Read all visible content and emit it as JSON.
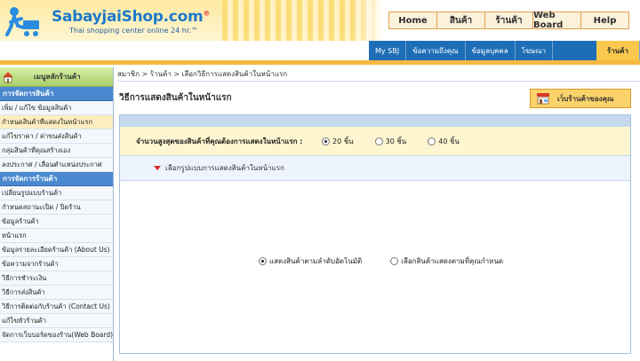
{
  "header": {
    "logo_text": "SabayjaiShop.com",
    "logo_reg": "®",
    "tagline": "Thai shopping center online 24 hr.™",
    "top_nav": [
      "Home",
      "สินค้า",
      "ร้านค้า",
      "Web Board",
      "Help"
    ],
    "sub_nav": [
      "My SBJ",
      "ข้อความถึงคุณ",
      "ข้อมูลบุคคล",
      "โฆษณา"
    ],
    "sub_nav_active": "ร้านค้า"
  },
  "sidebar": {
    "home_label": "เมนูหลักร้านค้า",
    "section1_title": "การจัดการสินค้า",
    "section1_items": [
      "เพิ่ม / แก้ไข ข้อมูลสินค้า",
      "กำหนดสินค้าที่แสดงในหน้าแรก",
      "แก้ไขราคา / ค่าขนส่งสินค้า",
      "กลุ่มสินค้าที่คุณสร้างเอง",
      "ลงประกาศ / เลื่อนตำแหน่งประกาศ"
    ],
    "section2_title": "การจัดการร้านค้า",
    "section2_items": [
      "เปลี่ยนรูปแบบร้านค้า",
      "กำหนดสถานะเปิด / ปิดร้าน",
      "ข้อมูลร้านค้า",
      "หน้าแรก",
      "ข้อมูลรายละเอียดร้านค้า (About Us)",
      "ข้อความจากร้านค้า",
      "วิธีการชำระเงิน",
      "วิธีการส่งสินค้า",
      "วิธีการติดต่อกับร้านค้า (Contact Us)",
      "แก้ไขหัวร้านค้า",
      "จัดการเว็บบอร์ดของร้าน(Web Board)"
    ]
  },
  "breadcrumb": "สมาชิก > ร้านค้า > เลือกวิธีการแสดงสินค้าในหน้าแรก",
  "main": {
    "title": "วิธีการแสดงสินค้าในหน้าแรก",
    "shop_button": "เว็บร้านค้าของคุณ",
    "qty_label": "จำนวนสูงสุดของสินค้าที่คุณต้องการแสดงในหน้าแรก :",
    "qty_options": [
      "20 ชิ้น",
      "30 ชิ้น",
      "40 ชิ้น"
    ],
    "qty_selected": "20 ชิ้น",
    "layout_label": "เลือกรูปแบบการแสดงสินค้าในหน้าแรก",
    "display_options": [
      "แสดงสินค้าตามลำดับอัตโนมัติ",
      "เลือกสินค้าแสดงตามที่คุณกำหนด"
    ],
    "display_selected": "แสดงสินค้าตามลำดับอัตโนมัติ"
  },
  "colors": {
    "accent_blue": "#1e6eb7",
    "accent_orange": "#f4b93e",
    "sidebar_head": "#4a89cf"
  }
}
